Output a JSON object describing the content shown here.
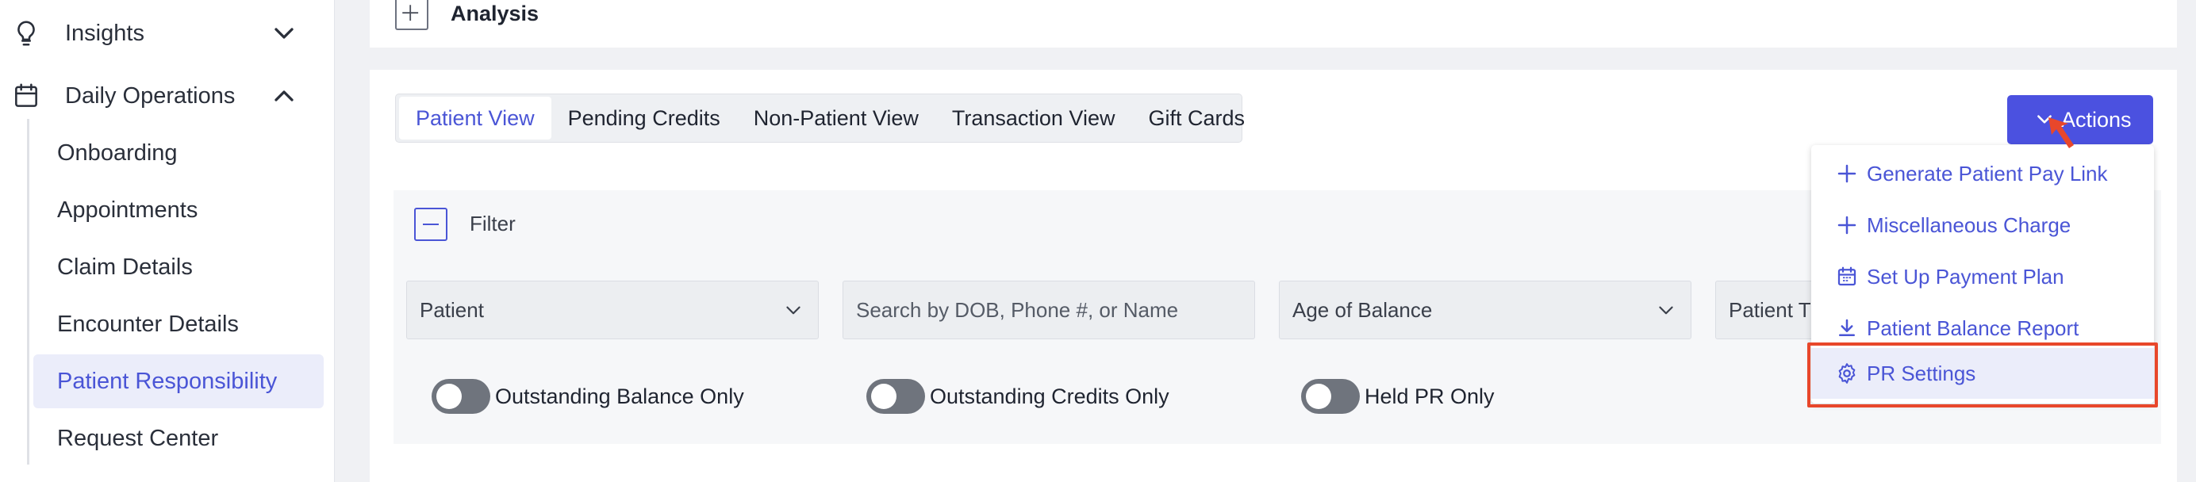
{
  "sidebar": {
    "groups": [
      {
        "label": "Insights",
        "icon": "lightbulb-icon",
        "expanded": false
      },
      {
        "label": "Daily Operations",
        "icon": "calendar-icon",
        "expanded": true
      }
    ],
    "items": [
      {
        "label": "Onboarding"
      },
      {
        "label": "Appointments"
      },
      {
        "label": "Claim Details"
      },
      {
        "label": "Encounter Details"
      },
      {
        "label": "Patient Responsibility",
        "active": true
      },
      {
        "label": "Request Center"
      }
    ]
  },
  "top_panel": {
    "label": "Analysis",
    "expand_icon": "plus-icon"
  },
  "tabs": [
    {
      "label": "Patient View",
      "active": true
    },
    {
      "label": "Pending Credits"
    },
    {
      "label": "Non-Patient View"
    },
    {
      "label": "Transaction View"
    },
    {
      "label": "Gift Cards"
    }
  ],
  "actions": {
    "label": "Actions",
    "icon": "chevron-down-icon",
    "menu": [
      {
        "label": "Generate Patient Pay Link",
        "icon": "plus-icon"
      },
      {
        "label": "Miscellaneous Charge",
        "icon": "plus-icon"
      },
      {
        "label": "Set Up Payment Plan",
        "icon": "calendar-icon"
      },
      {
        "label": "Patient Balance Report",
        "icon": "download-icon"
      },
      {
        "label": "PR Settings",
        "icon": "gear-icon",
        "highlighted": true
      }
    ]
  },
  "filter": {
    "label": "Filter",
    "collapse_icon": "minus-icon",
    "fields": {
      "patient": {
        "value": "Patient"
      },
      "search": {
        "placeholder": "Search by DOB, Phone #, or Name"
      },
      "age_of_balance": {
        "value": "Age of Balance"
      },
      "patient_type": {
        "value": "Patient T"
      }
    },
    "toggles": [
      {
        "label": "Outstanding Balance Only",
        "on": false
      },
      {
        "label": "Outstanding Credits Only",
        "on": false
      },
      {
        "label": "Held PR Only",
        "on": false
      }
    ]
  },
  "colors": {
    "accent": "#4b51e0",
    "accent_text": "#4a55d6",
    "highlight": "#e8472b",
    "active_bg": "#ebedfa"
  }
}
